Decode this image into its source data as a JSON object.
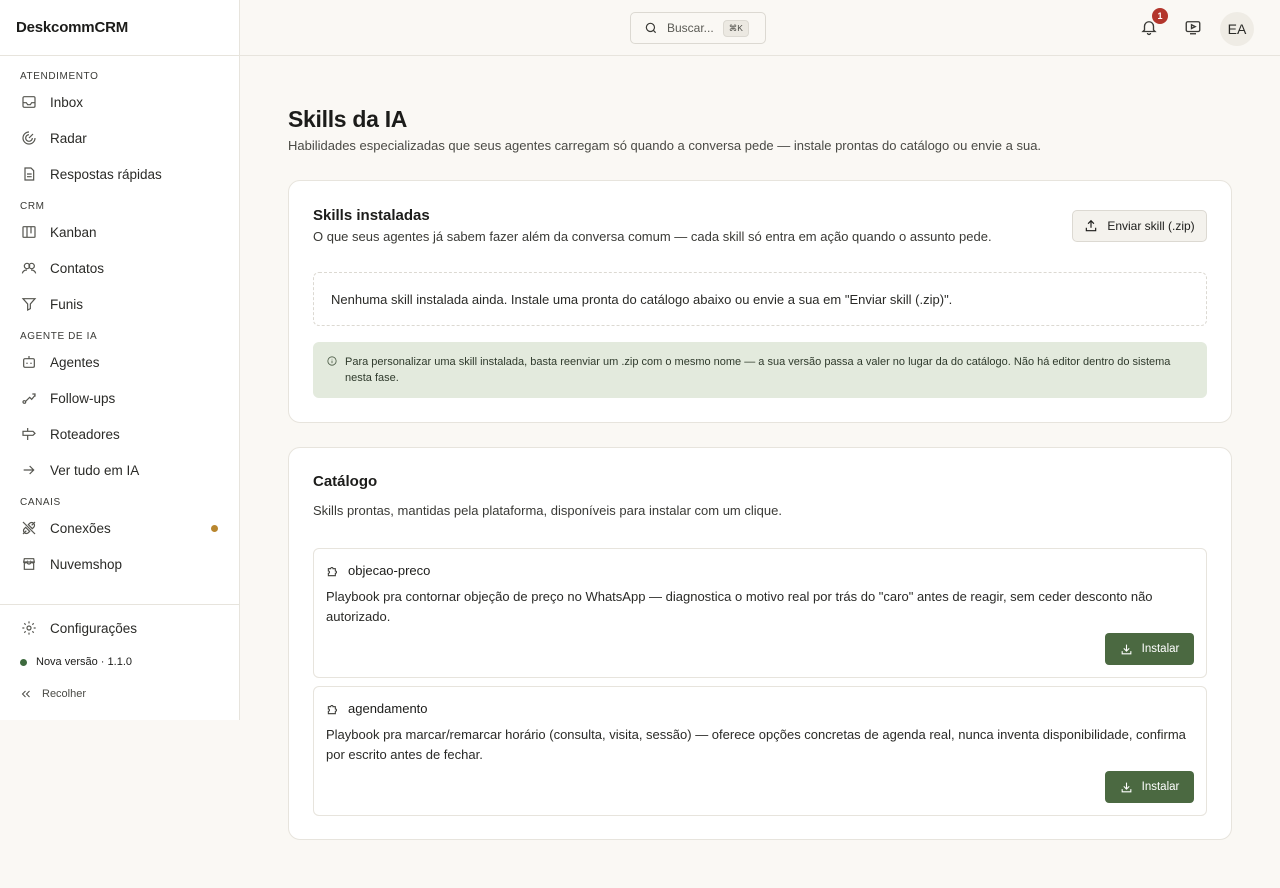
{
  "app": {
    "brand": "DeskcommCRM"
  },
  "sidebar": {
    "sections": [
      {
        "label": "ATENDIMENTO",
        "items": [
          {
            "label": "Inbox",
            "icon": "inbox-icon"
          },
          {
            "label": "Radar",
            "icon": "radar-icon"
          },
          {
            "label": "Respostas rápidas",
            "icon": "file-text-icon"
          }
        ]
      },
      {
        "label": "CRM",
        "items": [
          {
            "label": "Kanban",
            "icon": "kanban-icon"
          },
          {
            "label": "Contatos",
            "icon": "users-icon"
          },
          {
            "label": "Funis",
            "icon": "funnel-icon"
          }
        ]
      },
      {
        "label": "AGENTE DE IA",
        "items": [
          {
            "label": "Agentes",
            "icon": "bot-icon"
          },
          {
            "label": "Follow-ups",
            "icon": "route-icon"
          },
          {
            "label": "Roteadores",
            "icon": "signpost-icon"
          },
          {
            "label": "Ver tudo em IA",
            "icon": "arrow-right-icon"
          }
        ]
      },
      {
        "label": "CANAIS",
        "items": [
          {
            "label": "Conexões",
            "icon": "plug-icon",
            "status_color": "#b8862e"
          },
          {
            "label": "Nuvemshop",
            "icon": "store-icon"
          }
        ]
      }
    ],
    "footer": {
      "settings_label": "Configurações",
      "version_label": "Nova versão · 1.1.0",
      "version_dot_color": "#3d6a3e",
      "collapse_label": "Recolher"
    }
  },
  "topbar": {
    "search_placeholder": "Buscar...",
    "search_shortcut": "⌘K",
    "notifications_count": "1",
    "avatar_initials": "EA"
  },
  "page": {
    "title": "Skills da IA",
    "subtitle": "Habilidades especializadas que seus agentes carregam só quando a conversa pede — instale prontas do catálogo ou envie a sua."
  },
  "installed": {
    "title": "Skills instaladas",
    "subtitle": "O que seus agentes já sabem fazer além da conversa comum — cada skill só entra em ação quando o assunto pede.",
    "upload_label": "Enviar skill (.zip)",
    "empty_text": "Nenhuma skill instalada ainda. Instale uma pronta do catálogo abaixo ou envie a sua em \"Enviar skill (.zip)\".",
    "info_text": "Para personalizar uma skill instalada, basta reenviar um .zip com o mesmo nome — a sua versão passa a valer no lugar da do catálogo. Não há editor dentro do sistema nesta fase."
  },
  "catalog": {
    "title": "Catálogo",
    "subtitle": "Skills prontas, mantidas pela plataforma, disponíveis para instalar com um clique.",
    "install_label": "Instalar",
    "items": [
      {
        "name": "objecao-preco",
        "description": "Playbook pra contornar objeção de preço no WhatsApp — diagnostica o motivo real por trás do \"caro\" antes de reagir, sem ceder desconto não autorizado."
      },
      {
        "name": "agendamento",
        "description": "Playbook pra marcar/remarcar horário (consulta, visita, sessão) — oferece opções concretas de agenda real, nunca inventa disponibilidade, confirma por escrito antes de fechar."
      }
    ]
  },
  "colors": {
    "accent": "#4b6941",
    "badge": "#b3362c",
    "info_bg": "#e3eadd"
  }
}
